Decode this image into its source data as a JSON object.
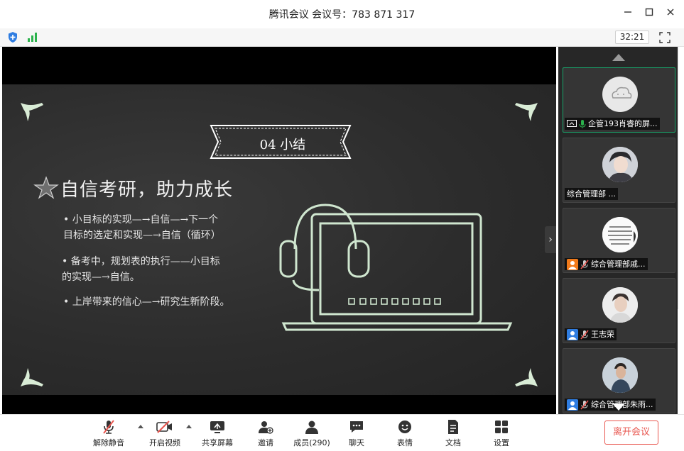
{
  "window": {
    "title": "腾讯会议 会议号：783 871 317",
    "minimize": "—",
    "maximize": "☐",
    "close": "✕"
  },
  "status": {
    "timer": "32:21"
  },
  "slide": {
    "banner": "04 小结",
    "heading": "自信考研，助力成长",
    "bullets": [
      {
        "line1": "• 小目标的实现—→自信—→下一个",
        "line2": "目标的选定和实现—→自信（循环）"
      },
      {
        "line1": "• 备考中，规划表的执行——小目标",
        "line2": "的实现—→自信。"
      },
      {
        "line1": "• 上岸带来的信心—→研究生新阶段。",
        "line2": ""
      }
    ],
    "side_arrow": "›"
  },
  "participants": [
    {
      "name": "企管193肖睿的屏...",
      "active": true,
      "icon": "screen-share-icon",
      "mic": "on",
      "avatar": "cloud"
    },
    {
      "name": "综合管理部 ...",
      "active": false,
      "icon": "",
      "mic": "",
      "avatar": "person-a"
    },
    {
      "name": "综合管理部戚...",
      "active": false,
      "icon": "user-orange-icon",
      "mic": "muted",
      "avatar": "text-card"
    },
    {
      "name": "王志荣",
      "active": false,
      "icon": "user-blue-icon",
      "mic": "muted",
      "avatar": "person-b"
    },
    {
      "name": "综合管理部朱雨...",
      "active": false,
      "icon": "user-blue-icon",
      "mic": "muted",
      "avatar": "person-c"
    }
  ],
  "toolbar": {
    "unmute": "解除静音",
    "start_video": "开启视频",
    "share_screen": "共享屏幕",
    "invite": "邀请",
    "members": "成员(290)",
    "chat": "聊天",
    "reactions": "表情",
    "documents": "文档",
    "settings": "设置",
    "leave": "离开会议"
  },
  "colors": {
    "accent_green": "#19a36a",
    "leave_red": "#e8554e",
    "slide_line": "#cfe6cf"
  }
}
